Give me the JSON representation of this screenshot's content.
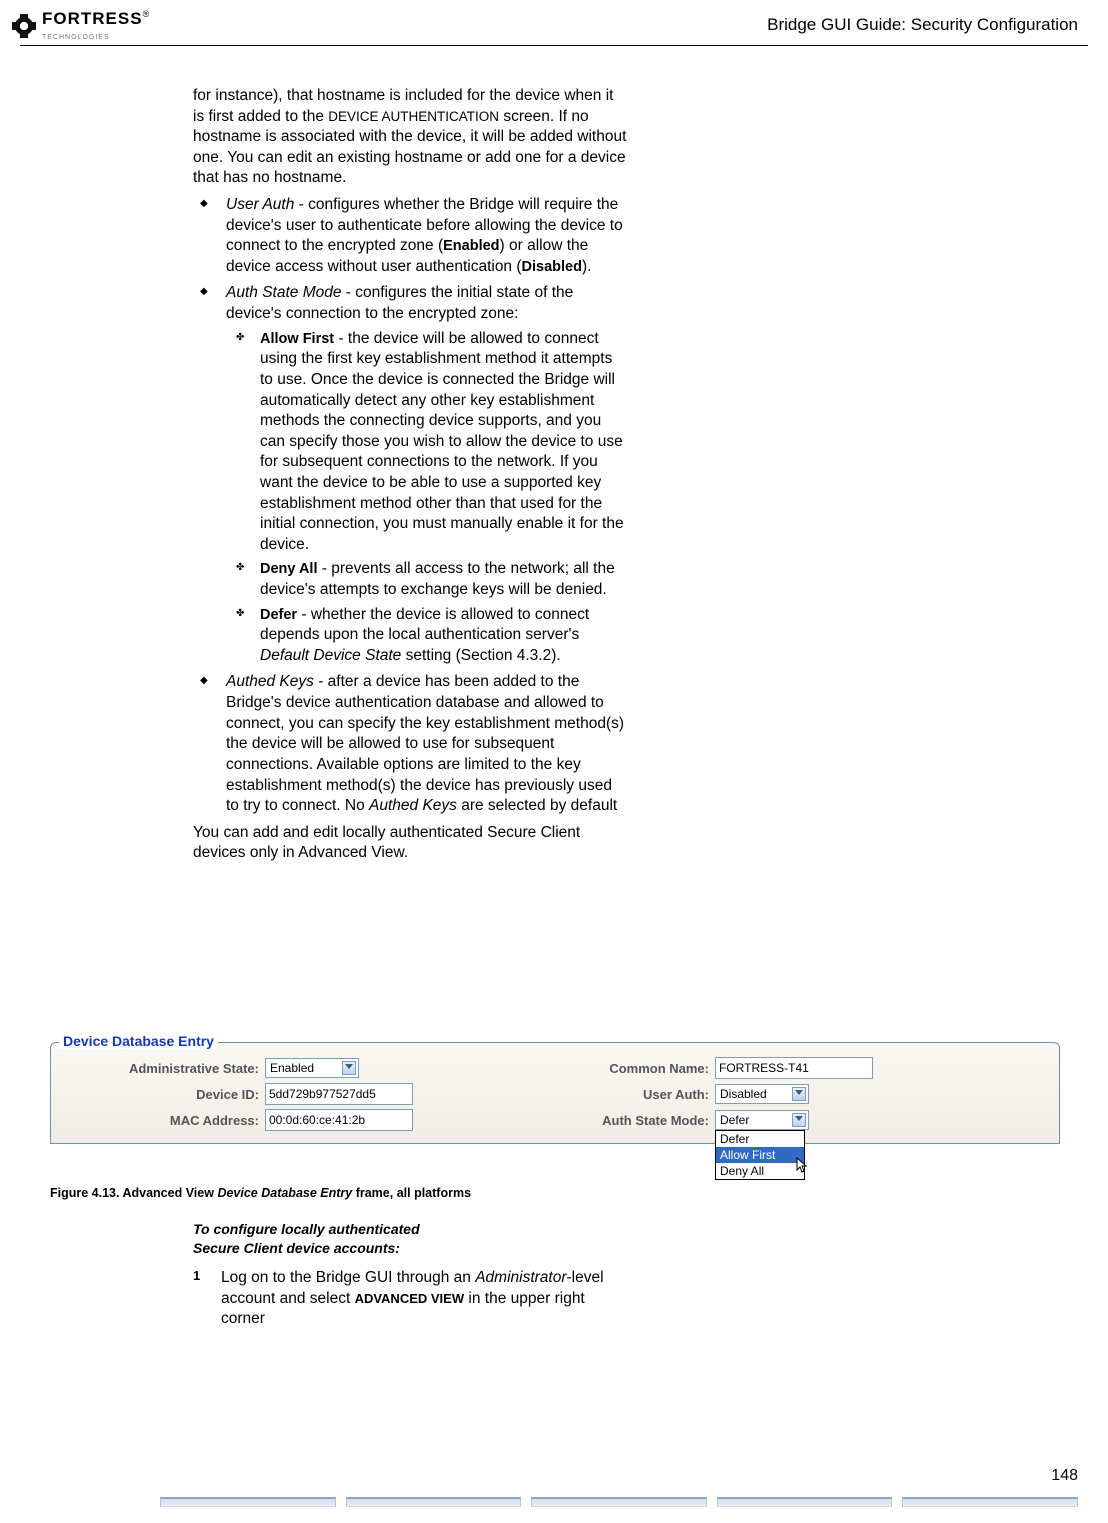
{
  "logo": {
    "brand_line1": "FORTRESS",
    "brand_reg": "®",
    "brand_line2": "TECHNOLOGIES"
  },
  "header": {
    "title": "Bridge GUI Guide: Security Configuration"
  },
  "intro_text": "for instance), that hostname is included for the device when it is first added to the ",
  "intro_smallcaps": "DEVICE AUTHENTICATION",
  "intro_text2": " screen. If no hostname is associated with the device, it will be added without one. You can edit an existing hostname or add one for a device that has no hostname.",
  "bullet_user_auth_label": "User Auth",
  "bullet_user_auth_a": " - configures whether the Bridge will require the device's user to authenticate before allowing the device to connect to the encrypted zone (",
  "bullet_user_auth_enabled": "Enabled",
  "bullet_user_auth_b": ") or allow the device access without user authentication (",
  "bullet_user_auth_disabled": "Disabled",
  "bullet_user_auth_c": ").",
  "bullet_asm_label": "Auth State Mode",
  "bullet_asm_text": " - configures the initial state of the device's connection to the encrypted zone:",
  "sub_allow_label": "Allow First",
  "sub_allow_text": " - the device will be allowed to connect using the first key establishment method it attempts to use. Once the device is connected the Bridge will automatically detect any other key establishment methods the connecting device supports, and you can specify those you wish to allow the device to use for subsequent connections to the network. If you want the device to be able to use a supported key establishment method other than that used for the initial connection, you must manually enable it for the device.",
  "sub_deny_label": "Deny All",
  "sub_deny_text": " - prevents all access to the network; all the device's attempts to exchange keys will be denied.",
  "sub_defer_label": "Defer",
  "sub_defer_a": " - whether the device is allowed to connect depends upon the local authentication server's ",
  "sub_defer_ital": "Default Device State",
  "sub_defer_b": " setting (Section 4.3.2).",
  "bullet_ak_label": "Authed Keys",
  "bullet_ak_a": " - after a device has been added to the Bridge's device authentication database and allowed to connect, you can specify the key establishment method(s) the device will be allowed to use for subsequent connections. Available options are limited to the key establishment method(s) the device has previously used to try to connect. No ",
  "bullet_ak_ital": "Authed Keys",
  "bullet_ak_b": " are selected by default",
  "closing_text": "You can add and edit locally authenticated Secure Client devices only in Advanced View.",
  "panel": {
    "legend": "Device Database Entry",
    "labels": {
      "admin_state": "Administrative State:",
      "device_id": "Device ID:",
      "mac": "MAC Address:",
      "common_name": "Common Name:",
      "user_auth": "User Auth:",
      "auth_mode": "Auth State Mode:"
    },
    "values": {
      "admin_state": "Enabled",
      "device_id": "5dd729b977527dd5",
      "mac": "00:0d:60:ce:41:2b",
      "common_name": "FORTRESS-T41",
      "user_auth": "Disabled",
      "auth_mode": "Defer"
    },
    "dropdown_options": [
      "Defer",
      "Allow First",
      "Deny All"
    ],
    "dropdown_selected_index": 1
  },
  "figure_caption_prefix": "Figure 4.13. Advanced View ",
  "figure_caption_ital": "Device Database Entry",
  "figure_caption_suffix": " frame, all platforms",
  "proc_heading_l1": "To configure locally authenticated",
  "proc_heading_l2": "Secure Client device accounts:",
  "step1_num": "1",
  "step1_a": "Log on to the Bridge GUI through an ",
  "step1_ital": "Administrator",
  "step1_b": "-level account and select ",
  "step1_caps": "ADVANCED VIEW",
  "step1_c": " in the upper right corner",
  "page_number": "148"
}
